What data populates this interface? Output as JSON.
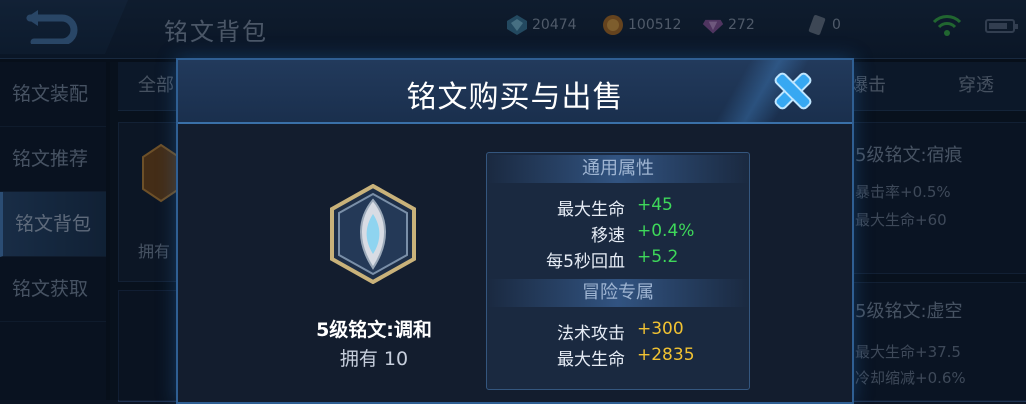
{
  "background": {
    "title": "铭文背包",
    "resources": [
      {
        "icon": "diamond-gem-icon",
        "value": "20474"
      },
      {
        "icon": "gold-coin-icon",
        "value": "100512"
      },
      {
        "icon": "crystal-icon",
        "value": "272"
      },
      {
        "icon": "ticket-icon",
        "value": "0"
      }
    ],
    "sidebar": [
      "铭文装配",
      "铭文推荐",
      "铭文背包",
      "铭文获取"
    ],
    "sidebar_active": 2,
    "tabs": [
      "全部",
      "爆击",
      "穿透"
    ],
    "left_card_owned": "拥有",
    "right_cards": [
      {
        "title": "5级铭文:宿痕",
        "lines": [
          "暴击率+0.5%",
          "最大生命+60"
        ]
      },
      {
        "title": "5级铭文:虚空",
        "lines": [
          "最大生命+37.5",
          "冷却缩减+0.6%"
        ]
      }
    ]
  },
  "modal": {
    "title": "铭文购买与出售",
    "rune_name": "5级铭文:调和",
    "owned": "拥有 10",
    "general_section": "通用属性",
    "general_stats": [
      {
        "label": "最大生命",
        "value": "+45"
      },
      {
        "label": "移速",
        "value": "+0.4%"
      },
      {
        "label": "每5秒回血",
        "value": "+5.2"
      }
    ],
    "adventure_section": "冒险专属",
    "adventure_stats": [
      {
        "label": "法术攻击",
        "value": "+300"
      },
      {
        "label": "最大生命",
        "value": "+2835"
      }
    ]
  },
  "colors": {
    "stat_green": "#3ed85a",
    "stat_gold": "#f1c232",
    "close_blue": "#37a8f2"
  }
}
